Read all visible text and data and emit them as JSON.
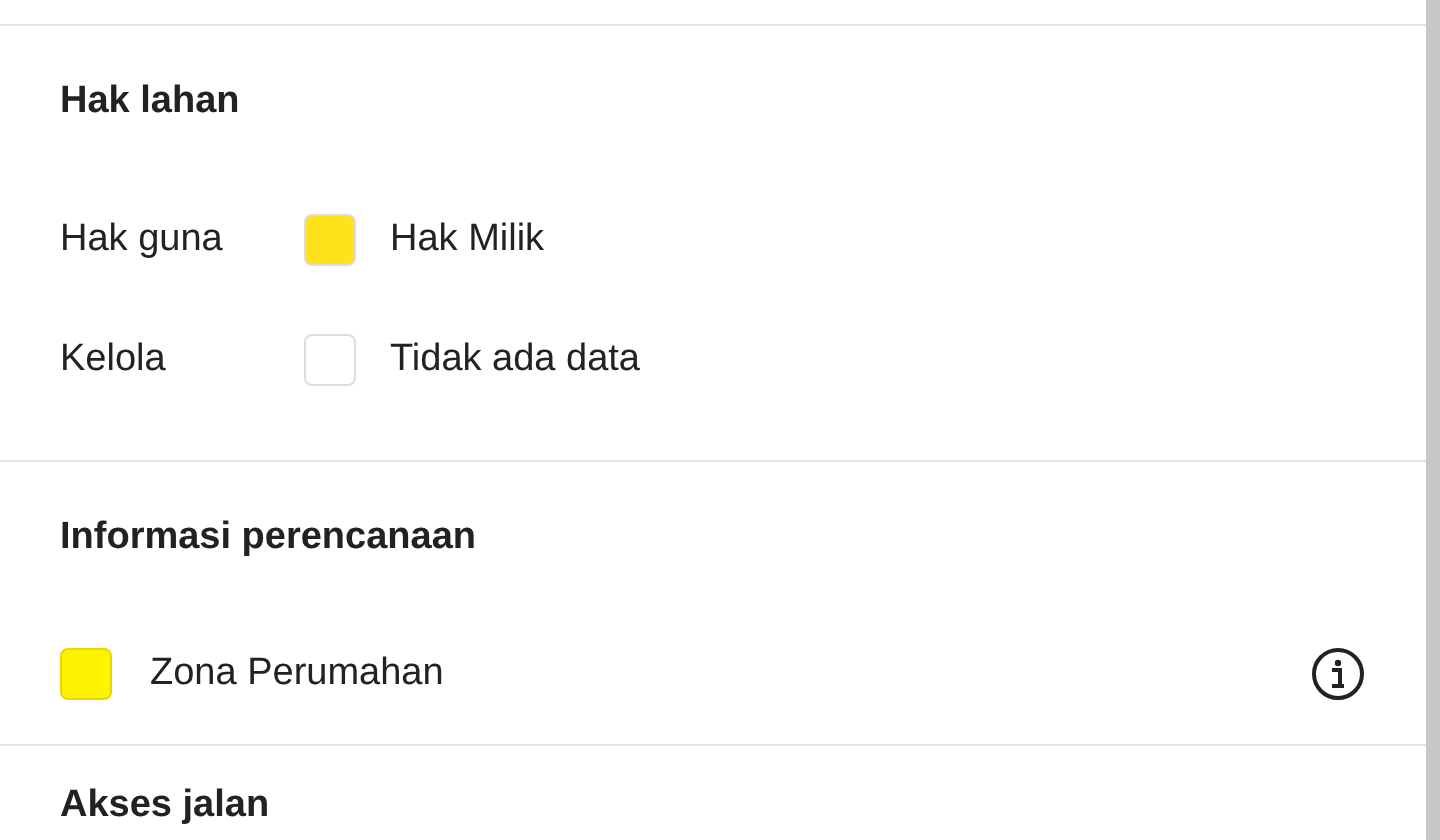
{
  "sections": [
    {
      "title": "Hak lahan",
      "kind": "legend",
      "rows": [
        {
          "label": "Hak guna",
          "value": "Hak Milik",
          "color": "#ffe21c"
        },
        {
          "label": "Kelola",
          "value": "Tidak ada data",
          "color": "#ffffff"
        }
      ]
    },
    {
      "title": "Informasi perencanaan",
      "kind": "zones",
      "rows": [
        {
          "value": "Zona Perumahan",
          "color": "#fff200"
        }
      ]
    },
    {
      "title": "Akses jalan",
      "kind": "heading"
    }
  ]
}
